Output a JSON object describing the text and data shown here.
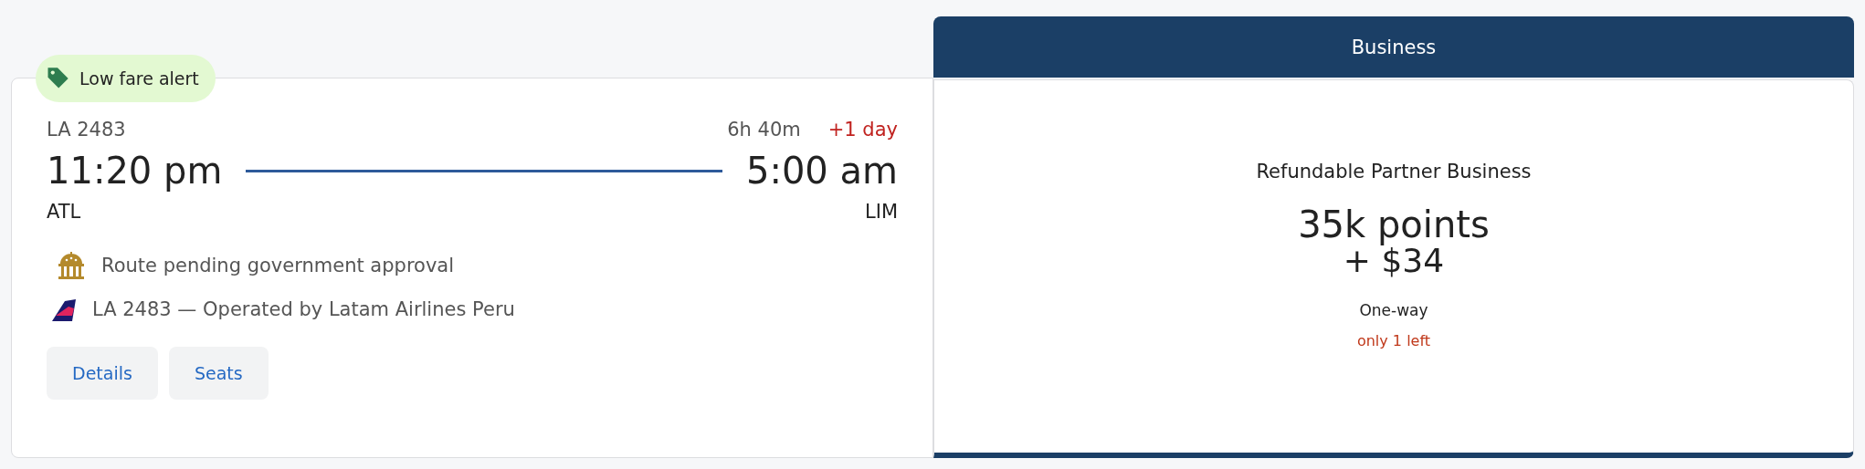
{
  "flight": {
    "badge": "Low fare alert",
    "flight_number": "LA 2483",
    "duration": "6h 40m",
    "day_offset": "+1 day",
    "departure_time": "11:20 pm",
    "arrival_time": "5:00 am",
    "origin": "ATL",
    "destination": "LIM",
    "notices": [
      {
        "kind": "government",
        "text": "Route pending government approval"
      },
      {
        "kind": "airline",
        "text": "LA 2483 — Operated by Latam Airlines Peru"
      }
    ],
    "buttons": [
      "Details",
      "Seats"
    ]
  },
  "fare": {
    "cabin": "Business",
    "name": "Refundable Partner Business",
    "points": "35k points",
    "cash": "+ $34",
    "trip_type": "One-way",
    "availability": "only 1 left"
  }
}
